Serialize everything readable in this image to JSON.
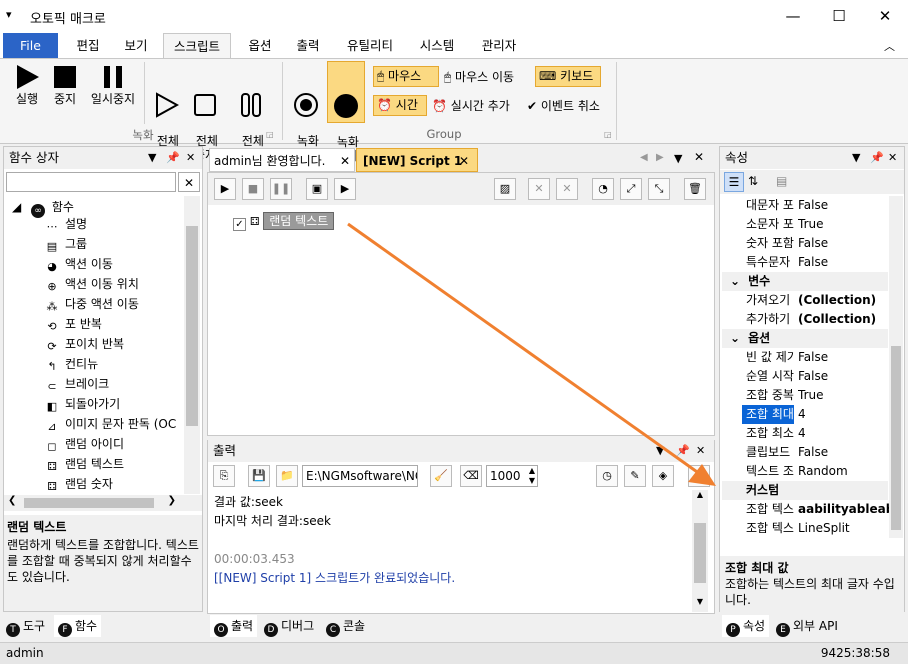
{
  "window": {
    "title": "오토픽 매크로"
  },
  "menu": {
    "tabs": [
      "File",
      "편집",
      "보기",
      "스크립트",
      "옵션",
      "출력",
      "유틸리티",
      "시스템",
      "관리자"
    ]
  },
  "ribbon": {
    "record_group": {
      "label": "녹화",
      "buttons": [
        "실행",
        "중지",
        "일시중지"
      ],
      "full": [
        "전체\n실행",
        "전체\n중지",
        "전체\n일시중지"
      ]
    },
    "group": {
      "label": "Group",
      "rec_start": "녹화\n시작",
      "rec_stop": "녹화\n중지",
      "mouse": "마우스",
      "mouse_move": "마우스 이동",
      "keyboard": "키보드",
      "time": "시간",
      "realtime_add": "실시간 추가",
      "event_cancel": "이벤트 취소"
    }
  },
  "func_panel": {
    "title": "함수 상자",
    "root": "함수",
    "items": [
      "설명",
      "그룹",
      "액션 이동",
      "액션 이동 위치",
      "다중 액션 이동",
      "포 반복",
      "포이치 반복",
      "컨티뉴",
      "브레이크",
      "되돌아가기",
      "이미지 문자 판독 (OC",
      "랜덤 아이디",
      "랜덤 텍스트",
      "랜덤 숫자"
    ],
    "desc_title": "랜덤 텍스트",
    "desc": "랜덤하게 텍스트를 조합합니다. 텍스트를 조합할 때 중복되지 않게 처리할수도 있습니다."
  },
  "doc_tabs": {
    "tab1": "admin님 환영합니다.",
    "tab2": "[NEW] Script 1",
    "script_item": "랜덤 텍스트"
  },
  "output": {
    "title": "출력",
    "path": "E:\\NGMsoftware\\NG",
    "delay": "1000",
    "lines": [
      "결과 값:seek",
      "마지막 처리 결과:seek"
    ],
    "time": "00:00:03.453",
    "done": "[[NEW] Script 1] 스크립트가 완료되었습니다."
  },
  "props": {
    "title": "속성",
    "rows1": [
      [
        "대문자 포",
        "False"
      ],
      [
        "소문자 포",
        "True"
      ],
      [
        "숫자 포함",
        "False"
      ],
      [
        "특수문자",
        "False"
      ]
    ],
    "cat_var": "변수",
    "rows2": [
      [
        "가져오기",
        "(Collection)"
      ],
      [
        "추가하기",
        "(Collection)"
      ]
    ],
    "cat_opt": "옵션",
    "rows3": [
      [
        "빈 값 제기",
        "False"
      ],
      [
        "순열 시작",
        "False"
      ],
      [
        "조합 중복",
        "True"
      ],
      [
        "조합 최대",
        "4"
      ],
      [
        "조합 최소",
        "4"
      ],
      [
        "클립보드",
        "False"
      ],
      [
        "텍스트 조",
        "Random"
      ]
    ],
    "cat_custom": "커스텀",
    "rows4": [
      [
        "조합 텍스",
        "aabilityableabo"
      ],
      [
        "조합 텍스",
        "LineSplit"
      ]
    ],
    "desc_title": "조합 최대 값",
    "desc": "조합하는 텍스트의 최대 글자 수입니다."
  },
  "bottom_tabs": {
    "left": [
      "도구",
      "함수"
    ],
    "mid": [
      "출력",
      "디버그",
      "콘솔"
    ],
    "right": [
      "속성",
      "외부 API"
    ]
  },
  "status": {
    "user": "admin",
    "coords": "9425:38:58"
  }
}
